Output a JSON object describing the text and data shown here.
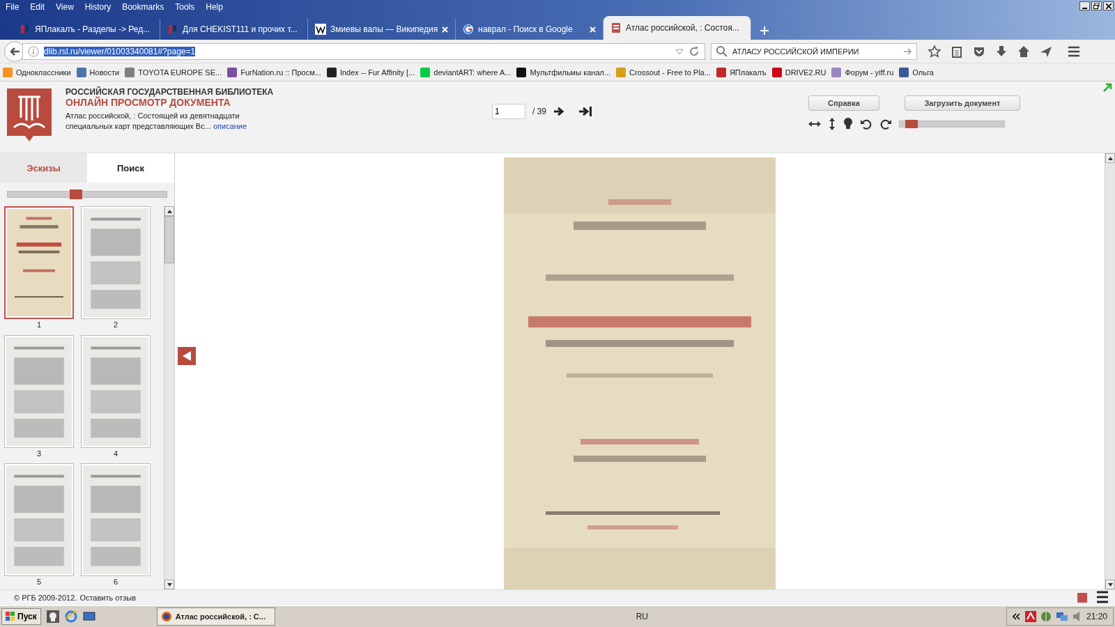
{
  "menu": [
    "File",
    "Edit",
    "View",
    "History",
    "Bookmarks",
    "Tools",
    "Help"
  ],
  "tabs": [
    {
      "title": "ЯПлакалъ - Разделы -> Ред...",
      "selected": false
    },
    {
      "title": "Для CHEKIST111 и прочих т...",
      "selected": false
    },
    {
      "title": "Змиевы валы — Википедия",
      "selected": false
    },
    {
      "title": "наврал - Поиск в Google",
      "selected": false
    },
    {
      "title": "Атлас российской, : Состоя...",
      "selected": true
    }
  ],
  "address": {
    "value": "dlib.rsl.ru/viewer/01003340081#?page=1"
  },
  "search": {
    "value": "АТЛАСУ РОССИЙСКОЙ ИМПЕРИИ"
  },
  "bookmarks": [
    {
      "label": "Одноклассники",
      "color": "#f7931e"
    },
    {
      "label": "Новости",
      "color": "#4a76a8"
    },
    {
      "label": "TOYOTA EUROPE SE...",
      "color": "#808080"
    },
    {
      "label": "FurNation.ru :: Просм...",
      "color": "#7a4fa0"
    },
    {
      "label": "Index -- Fur Affinity [...",
      "color": "#222222"
    },
    {
      "label": "deviantART: where A...",
      "color": "#05cc47"
    },
    {
      "label": "Мультфильмы канал...",
      "color": "#111111"
    },
    {
      "label": "Crossout - Free to Pla...",
      "color": "#d4a017"
    },
    {
      "label": "ЯПлакалъ",
      "color": "#c0282d"
    },
    {
      "label": "DRIVE2.RU",
      "color": "#d0021b"
    },
    {
      "label": "Форум - yiff.ru",
      "color": "#9a88c0"
    },
    {
      "label": "Ольга",
      "color": "#3b5998"
    }
  ],
  "site": {
    "org": "РОССИЙСКАЯ ГОСУДАРСТВЕННАЯ БИБЛИОТЕКА",
    "subtitle": "ОНЛАЙН ПРОСМОТР ДОКУМЕНТА",
    "description": "Атлас российской, : Состоящей из девятнадцати специальных карт представляющих Вс...",
    "link": "описание"
  },
  "pager": {
    "page": "1",
    "total": "/ 39"
  },
  "buttons": [
    "Справка",
    "Загрузить документ"
  ],
  "zoom": {
    "level": 0.05
  },
  "sidebar": {
    "tabs": [
      {
        "label": "Эскизы",
        "selected": true
      },
      {
        "label": "Поиск",
        "selected": false
      }
    ],
    "size_slider": {
      "level": 0.43
    },
    "thumbnails": [
      {
        "label": "1",
        "selected": true
      },
      {
        "label": "2",
        "selected": false
      },
      {
        "label": "3",
        "selected": false
      },
      {
        "label": "4",
        "selected": false
      },
      {
        "label": "5",
        "selected": false
      },
      {
        "label": "6",
        "selected": false
      }
    ]
  },
  "footer": {
    "copyright": "© РГБ 2009-2012.",
    "link": "Оставить отзыв"
  },
  "taskbar": {
    "start": "Пуск",
    "task": "Атлас российской, : С...",
    "language": "RU",
    "clock": "21:20"
  }
}
